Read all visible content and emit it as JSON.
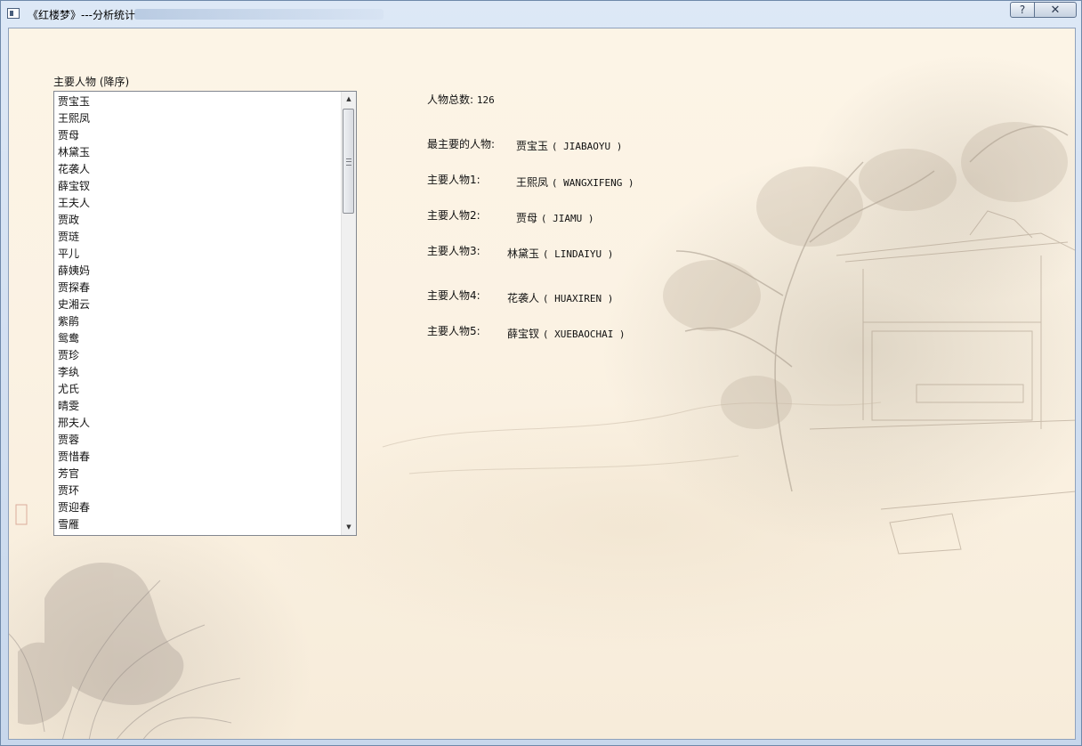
{
  "window": {
    "title": "《红楼梦》---分析统计",
    "help_label": "?",
    "close_label": "✕"
  },
  "list": {
    "heading": "主要人物 (降序)",
    "items": [
      "贾宝玉",
      "王熙凤",
      "贾母",
      "林黛玉",
      "花袭人",
      "薛宝钗",
      "王夫人",
      "贾政",
      "贾琏",
      "平儿",
      "薛姨妈",
      "贾探春",
      "史湘云",
      "紫鹃",
      "鸳鸯",
      "贾珍",
      "李纨",
      "尤氏",
      "晴雯",
      "邢夫人",
      "贾蓉",
      "贾惜春",
      "芳官",
      "贾环",
      "贾迎春",
      "雪雁"
    ]
  },
  "stats": {
    "total_label": "人物总数:",
    "total_value": "126",
    "main_label": "最主要的人物:",
    "main_name": "贾宝玉",
    "main_pinyin": "( JIABAOYU )",
    "rows": [
      {
        "label": "主要人物1:",
        "name": "王熙凤",
        "pinyin": "( WANGXIFENG )"
      },
      {
        "label": "主要人物2:",
        "name": "贾母",
        "pinyin": "( JIAMU )"
      },
      {
        "label": "主要人物3:",
        "name": "林黛玉",
        "pinyin": "( LINDAIYU )"
      },
      {
        "label": "主要人物4:",
        "name": "花袭人",
        "pinyin": "( HUAXIREN )"
      },
      {
        "label": "主要人物5:",
        "name": "薛宝钗",
        "pinyin": "( XUEBAOCHAI )"
      }
    ]
  },
  "colors": {
    "background_paper": "#fbf2e3",
    "window_frame": "#c7d7ec"
  }
}
